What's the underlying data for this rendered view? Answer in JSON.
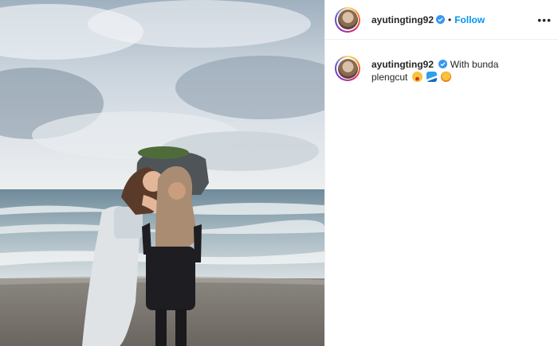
{
  "post": {
    "username": "ayutingting92",
    "follow_label": "Follow",
    "separator": "•",
    "more_label": "•••",
    "caption": "With bunda plengcut",
    "caption_emojis": [
      "grinning-face-emoji",
      "wave-emoji",
      "smiling-face-emoji"
    ]
  },
  "colors": {
    "follow_blue": "#0095f6",
    "verified_blue": "#3897f0",
    "text": "#262626",
    "divider": "#efefef"
  }
}
